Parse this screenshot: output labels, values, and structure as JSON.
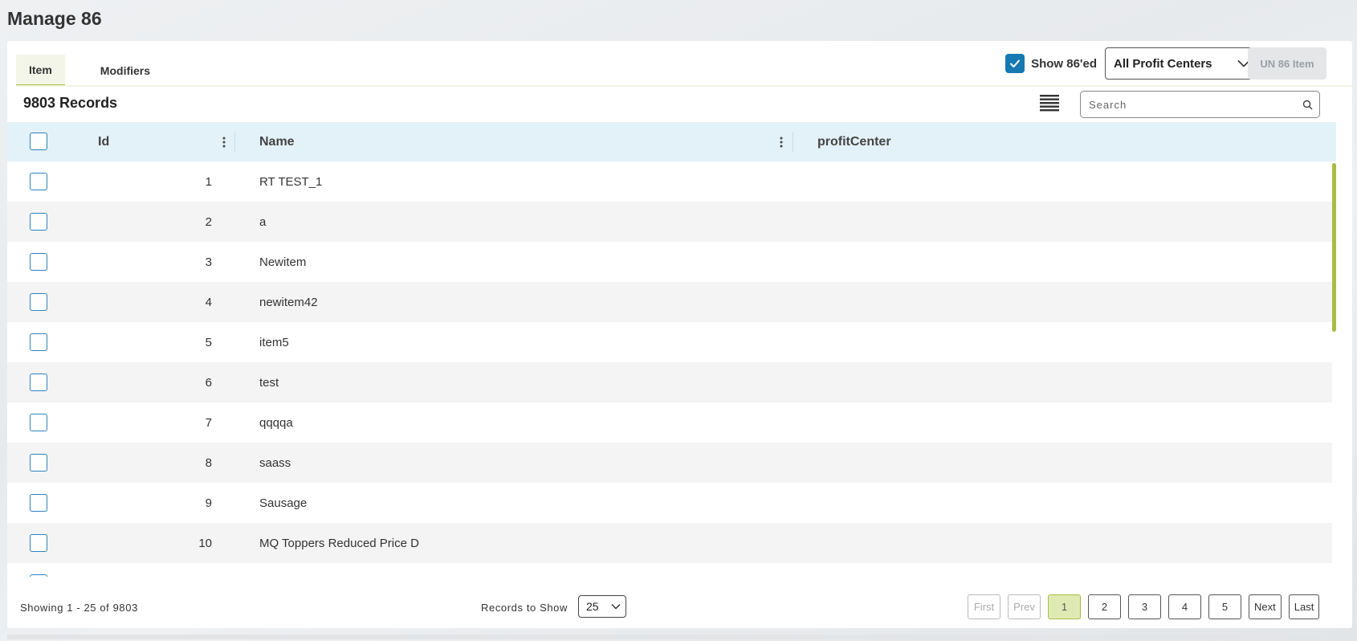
{
  "page": {
    "title": "Manage 86"
  },
  "tabs": [
    {
      "label": "Item",
      "active": true
    },
    {
      "label": "Modifiers",
      "active": false
    }
  ],
  "controls": {
    "show86_label": "Show 86'ed",
    "show86_checked": true,
    "profit_center_value": "All Profit Centers",
    "un86_label": "UN 86 Item"
  },
  "records": {
    "count_label": "9803 Records",
    "search_placeholder": "Search"
  },
  "grid": {
    "columns": [
      "Id",
      "Name",
      "profitCenter"
    ],
    "rows": [
      {
        "id": "1",
        "name": "RT TEST_1"
      },
      {
        "id": "2",
        "name": "a"
      },
      {
        "id": "3",
        "name": "Newitem"
      },
      {
        "id": "4",
        "name": "newitem42"
      },
      {
        "id": "5",
        "name": "item5"
      },
      {
        "id": "6",
        "name": "test"
      },
      {
        "id": "7",
        "name": "qqqqa"
      },
      {
        "id": "8",
        "name": "saass"
      },
      {
        "id": "9",
        "name": "Sausage"
      },
      {
        "id": "10",
        "name": "MQ Toppers Reduced Price D"
      }
    ]
  },
  "footer": {
    "showing": "Showing 1 - 25 of 9803",
    "records_to_show_label": "Records to Show",
    "records_to_show_value": "25",
    "pager": {
      "first": "First",
      "prev": "Prev",
      "pages": [
        "1",
        "2",
        "3",
        "4",
        "5"
      ],
      "current": "1",
      "next": "Next",
      "last": "Last"
    }
  },
  "colors": {
    "accent": "#a9bd45",
    "header_bg": "#e3f1f9",
    "checkbox_blue": "#1679b2"
  },
  "icons": {
    "checkbox_checked": "check-icon",
    "dropdown": "chevron-down-icon",
    "list_view": "list-view-icon",
    "search": "search-icon",
    "column_menu": "kebab-menu-icon"
  }
}
